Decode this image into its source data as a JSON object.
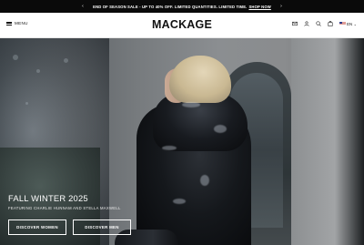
{
  "announcement": {
    "message": "END OF SEASON SALE - UP TO 40% OFF. LIMITED QUANTITIES. LIMITED TIME.",
    "link_label": "SHOP NOW",
    "prev_icon": "chevron-left-icon",
    "next_icon": "chevron-right-icon"
  },
  "header": {
    "menu_label": "MENU",
    "logo": "MACKAGE",
    "icons": [
      "mail-icon",
      "user-icon",
      "search-icon",
      "bag-icon"
    ],
    "locale": "EN"
  },
  "hero": {
    "title": "FALL WINTER 2025",
    "subtitle": "FEATURING CHARLIE HUNNAM AND STELLA MAXWELL",
    "cta_women": "DISCOVER WOMEN",
    "cta_men": "DISCOVER MEN"
  },
  "colors": {
    "announcement_bg": "#0a0a0a",
    "header_bg": "#ffffff",
    "text_on_dark": "#ffffff"
  }
}
